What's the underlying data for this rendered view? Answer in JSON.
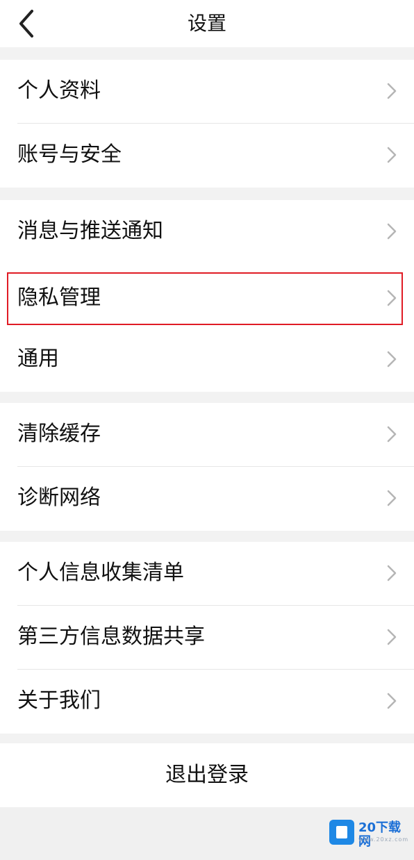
{
  "header": {
    "title": "设置",
    "back_icon": "chevron-left-icon"
  },
  "groups": [
    {
      "items": [
        {
          "label": "个人资料"
        },
        {
          "label": "账号与安全"
        }
      ]
    },
    {
      "items": [
        {
          "label": "消息与推送通知"
        },
        {
          "label": "隐私管理",
          "highlighted": true
        },
        {
          "label": "通用"
        }
      ]
    },
    {
      "items": [
        {
          "label": "清除缓存"
        },
        {
          "label": "诊断网络"
        }
      ]
    },
    {
      "items": [
        {
          "label": "个人信息收集清单"
        },
        {
          "label": "第三方信息数据共享"
        },
        {
          "label": "关于我们"
        }
      ]
    }
  ],
  "logout": {
    "label": "退出登录"
  },
  "watermark": {
    "name": "20下载网",
    "url": "www.20xz.com"
  },
  "colors": {
    "highlight_border": "#e01b24",
    "background": "#f2f2f2",
    "card": "#ffffff",
    "chevron": "#b5b5b5"
  }
}
